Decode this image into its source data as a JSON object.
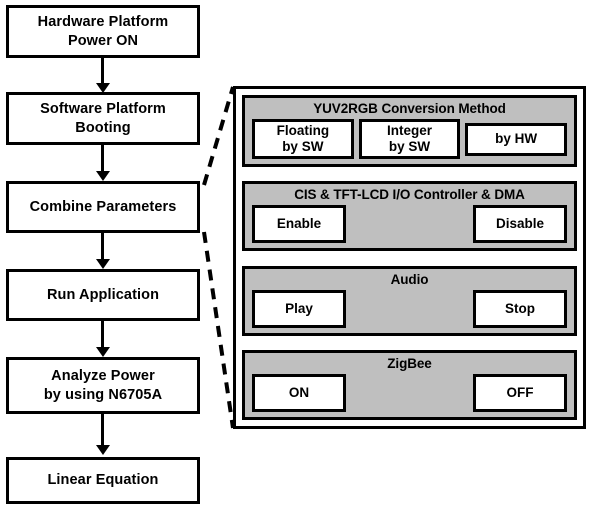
{
  "flowchart": {
    "steps": [
      {
        "id": "hardware-platform-power-on",
        "line1": "Hardware Platform",
        "line2": "Power ON"
      },
      {
        "id": "software-platform-booting",
        "line1": "Software Platform",
        "line2": "Booting"
      },
      {
        "id": "combine-parameters",
        "line1": "Combine Parameters",
        "line2": ""
      },
      {
        "id": "run-application",
        "line1": "Run Application",
        "line2": ""
      },
      {
        "id": "analyze-power",
        "line1": "Analyze Power",
        "line2": "by using  N6705A"
      },
      {
        "id": "linear-equation",
        "line1": "Linear Equation",
        "line2": ""
      }
    ]
  },
  "panel": {
    "groups": [
      {
        "title": "YUV2RGB  Conversion  Method",
        "options": [
          {
            "line1": "Floating",
            "line2": "by  SW"
          },
          {
            "line1": "Integer",
            "line2": "by  SW"
          },
          {
            "line1": "by  HW",
            "line2": ""
          }
        ]
      },
      {
        "title": "CIS & TFT-LCD I/O Controller  & DMA",
        "options": [
          {
            "line1": "Enable",
            "line2": ""
          },
          {
            "line1": "Disable",
            "line2": ""
          }
        ]
      },
      {
        "title": "Audio",
        "options": [
          {
            "line1": "Play",
            "line2": ""
          },
          {
            "line1": "Stop",
            "line2": ""
          }
        ]
      },
      {
        "title": "ZigBee",
        "options": [
          {
            "line1": "ON",
            "line2": ""
          },
          {
            "line1": "OFF",
            "line2": ""
          }
        ]
      }
    ]
  },
  "colors": {
    "stroke": "#000000",
    "group_fill": "#bfbfbf",
    "button_fill": "#ffffff",
    "page_background": "#ffffff"
  }
}
